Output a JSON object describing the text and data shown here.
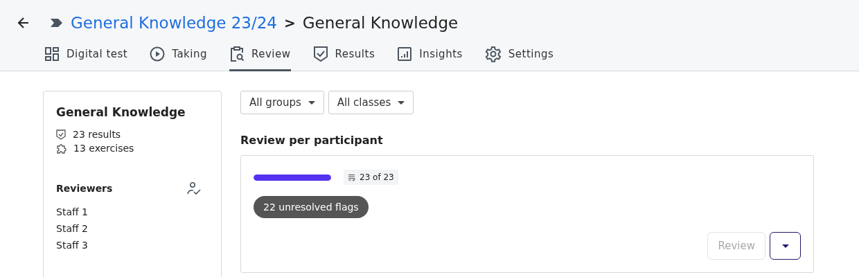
{
  "breadcrumb": {
    "parent": "General Knowledge 23/24",
    "separator": ">",
    "current": "General Knowledge"
  },
  "tabs": [
    {
      "label": "Digital test",
      "selected": false
    },
    {
      "label": "Taking",
      "selected": false
    },
    {
      "label": "Review",
      "selected": true
    },
    {
      "label": "Results",
      "selected": false
    },
    {
      "label": "Insights",
      "selected": false
    },
    {
      "label": "Settings",
      "selected": false
    }
  ],
  "summary": {
    "title": "General Knowledge",
    "stats": [
      "23 results",
      "13 exercises"
    ],
    "reviewers_heading": "Reviewers",
    "reviewers": [
      "Staff 1",
      "Staff 2",
      "Staff 3"
    ]
  },
  "filters": [
    "All groups",
    "All classes"
  ],
  "section_title": "Review per participant",
  "review_card": {
    "level": 1,
    "count": "23 of 23",
    "flags": "22 unresolved flags",
    "review_button": {
      "label": "Review",
      "disabled": true
    }
  }
}
